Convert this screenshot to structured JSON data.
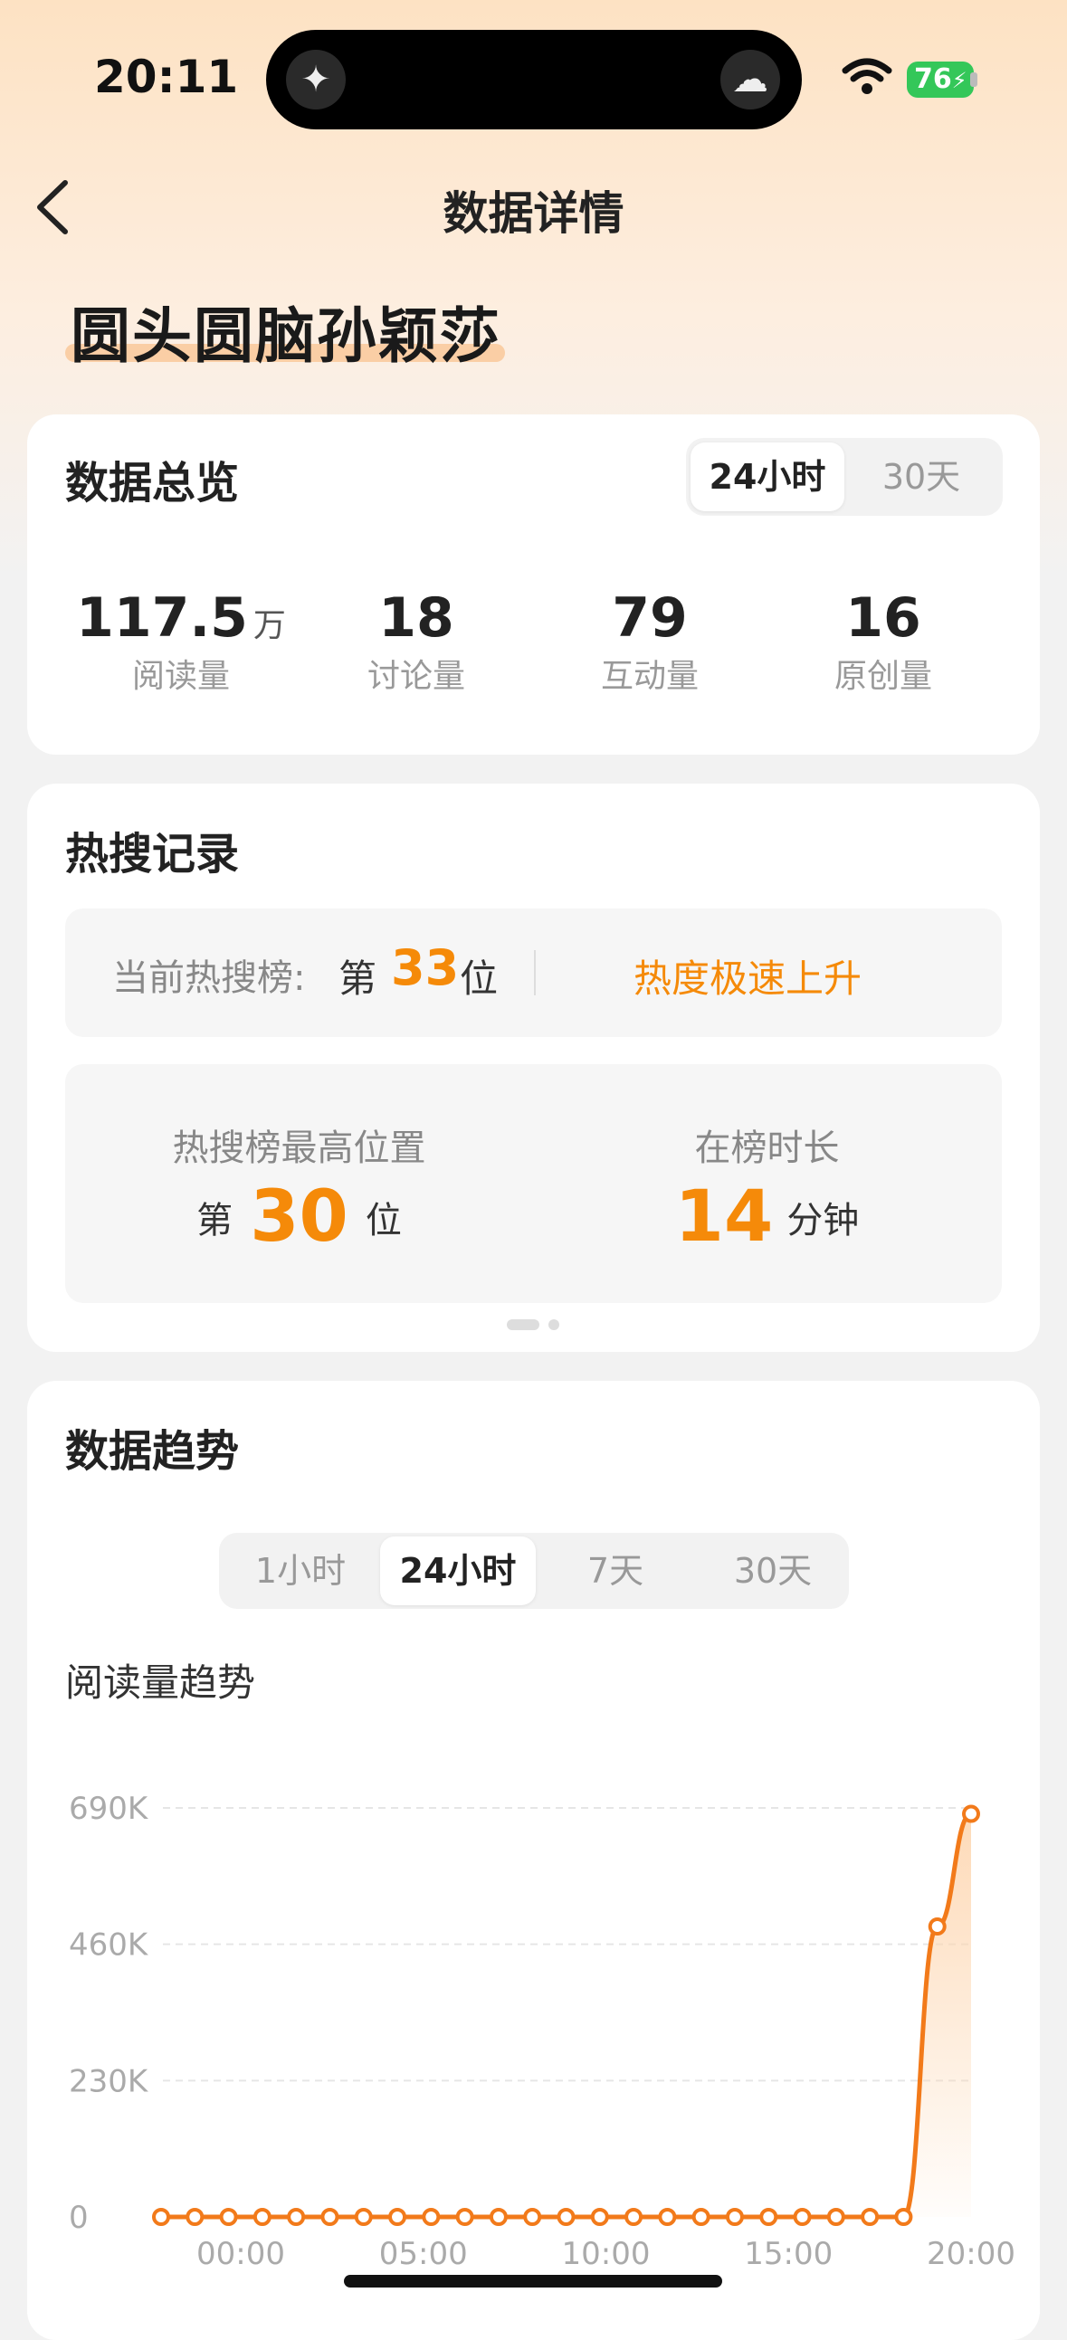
{
  "status_bar": {
    "time": "20:11",
    "battery": "76"
  },
  "header": {
    "title": "数据详情",
    "back_icon": "chevron-left-icon"
  },
  "topic": {
    "title": "圆头圆脑孙颖莎"
  },
  "overview": {
    "title": "数据总览",
    "tabs": [
      "24小时",
      "30天"
    ],
    "active_tab": "24小时",
    "stats": [
      {
        "value": "117.5",
        "unit": "万",
        "label": "阅读量"
      },
      {
        "value": "18",
        "unit": "",
        "label": "讨论量"
      },
      {
        "value": "79",
        "unit": "",
        "label": "互动量"
      },
      {
        "value": "16",
        "unit": "",
        "label": "原创量"
      }
    ]
  },
  "hot_search": {
    "title": "热搜记录",
    "current_label": "当前热搜榜:",
    "rank_prefix": "第",
    "current_rank": "33",
    "rank_suffix": "位",
    "trend_status": "热度极速上升",
    "highest_label": "热搜榜最高位置",
    "highest_rank": "30",
    "duration_label": "在榜时长",
    "duration_value": "14",
    "duration_unit": "分钟"
  },
  "trend": {
    "title": "数据趋势",
    "tabs": [
      "1小时",
      "24小时",
      "7天",
      "30天"
    ],
    "active_tab": "24小时",
    "chart_title": "阅读量趋势"
  },
  "chart_data": {
    "type": "area",
    "title": "阅读量趋势",
    "y_ticks": [
      "0",
      "230K",
      "460K",
      "690K"
    ],
    "ylim": [
      0,
      690000
    ],
    "x_ticks": [
      "00:00",
      "05:00",
      "10:00",
      "15:00",
      "20:00"
    ],
    "series": [
      {
        "values": [
          0,
          0,
          0,
          0,
          0,
          0,
          0,
          0,
          0,
          0,
          0,
          0,
          0,
          0,
          0,
          0,
          0,
          0,
          0,
          0,
          0,
          0,
          0,
          490000,
          680000
        ]
      }
    ],
    "colors": {
      "line": "#f27a1a",
      "fill": "#fdd6b0"
    },
    "grid": true
  }
}
